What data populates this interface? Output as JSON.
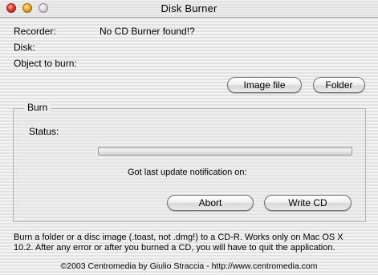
{
  "window": {
    "title": "Disk Burner"
  },
  "fields": {
    "recorder_label": "Recorder:",
    "recorder_value": "No CD Burner found!?",
    "disk_label": "Disk:",
    "object_label": "Object to burn:"
  },
  "buttons": {
    "image_file": "Image file",
    "folder": "Folder",
    "abort": "Abort",
    "write_cd": "Write CD"
  },
  "burn": {
    "group_title": "Burn",
    "status_label": "Status:",
    "progress_fraction": 0,
    "update_notification": "Got last update notification on:"
  },
  "info": {
    "line1": "Burn a folder or a disc image (.toast, not .dmg!) to a CD-R. Works only on Mac OS X",
    "line2": "10.2. After any error or after you burned a CD, you will have to quit the application."
  },
  "footer": {
    "copyright": "©2003 Centromedia by Giulio Straccia - http://www.centromedia.com"
  }
}
